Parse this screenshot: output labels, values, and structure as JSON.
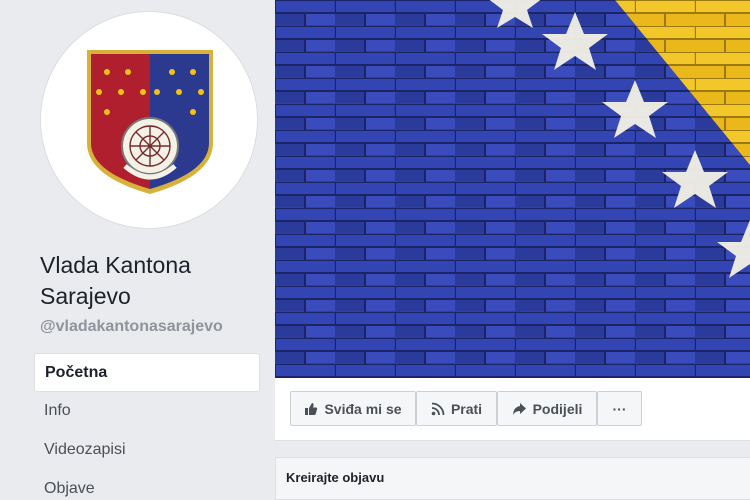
{
  "page": {
    "name": "Vlada Kantona Sarajevo",
    "handle": "@vladakantonasarajevo"
  },
  "nav": {
    "items": [
      {
        "label": "Početna",
        "active": true
      },
      {
        "label": "Info",
        "active": false
      },
      {
        "label": "Videozapisi",
        "active": false
      },
      {
        "label": "Objave",
        "active": false
      }
    ]
  },
  "actions": {
    "like_label": "Sviđa mi se",
    "follow_label": "Prati",
    "share_label": "Podijeli",
    "more_label": "···"
  },
  "composer": {
    "title": "Kreirajte objavu"
  },
  "colors": {
    "crest_red": "#b01f2d",
    "crest_blue": "#2b3a8f",
    "crest_gold": "#d7b23a",
    "flag_blue": "#2a3aa0",
    "flag_yellow": "#f2c21b",
    "star_white": "#f4f1e6"
  },
  "icons": {
    "like": "thumbs-up-icon",
    "follow": "rss-icon",
    "share": "share-arrow-icon"
  }
}
